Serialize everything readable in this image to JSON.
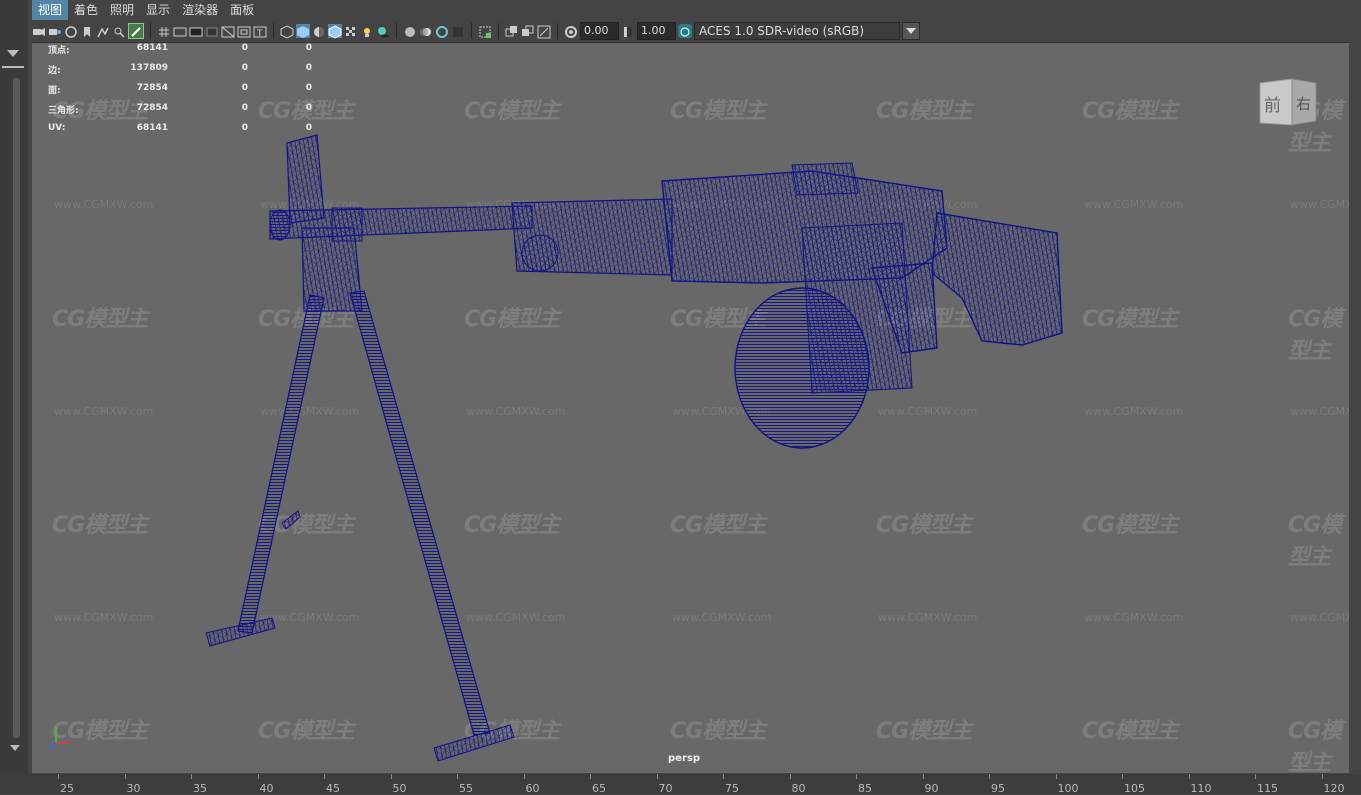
{
  "menu": {
    "items": [
      {
        "label": "视图",
        "active": true
      },
      {
        "label": "着色",
        "active": false
      },
      {
        "label": "照明",
        "active": false
      },
      {
        "label": "显示",
        "active": false
      },
      {
        "label": "渲染器",
        "active": false
      },
      {
        "label": "面板",
        "active": false
      }
    ]
  },
  "toolbar": {
    "exposure_value": "0.00",
    "gamma_value": "1.00",
    "color_space": "ACES 1.0 SDR-video (sRGB)"
  },
  "hud": {
    "rows": [
      {
        "label": "顶点:",
        "total": "68141",
        "selected": "0",
        "component": "0"
      },
      {
        "label": "边:",
        "total": "137809",
        "selected": "0",
        "component": "0"
      },
      {
        "label": "面:",
        "total": "72854",
        "selected": "0",
        "component": "0"
      },
      {
        "label": "三角形:",
        "total": "72854",
        "selected": "0",
        "component": "0"
      },
      {
        "label": "UV:",
        "total": "68141",
        "selected": "0",
        "component": "0"
      }
    ]
  },
  "view_cube": {
    "front": "前",
    "right": "右"
  },
  "camera_label": "persp",
  "watermark": {
    "logo": "CG模型主",
    "url": "www.CGMXW.com"
  },
  "timeline": {
    "ticks": [
      "25",
      "30",
      "35",
      "40",
      "45",
      "50",
      "55",
      "60",
      "65",
      "70",
      "75",
      "80",
      "85",
      "90",
      "95",
      "100",
      "105",
      "110",
      "115",
      "120"
    ]
  },
  "colors": {
    "viewport_bg": "#686868",
    "wireframe": "#1a1a8c",
    "menu_active": "#5285a6"
  }
}
